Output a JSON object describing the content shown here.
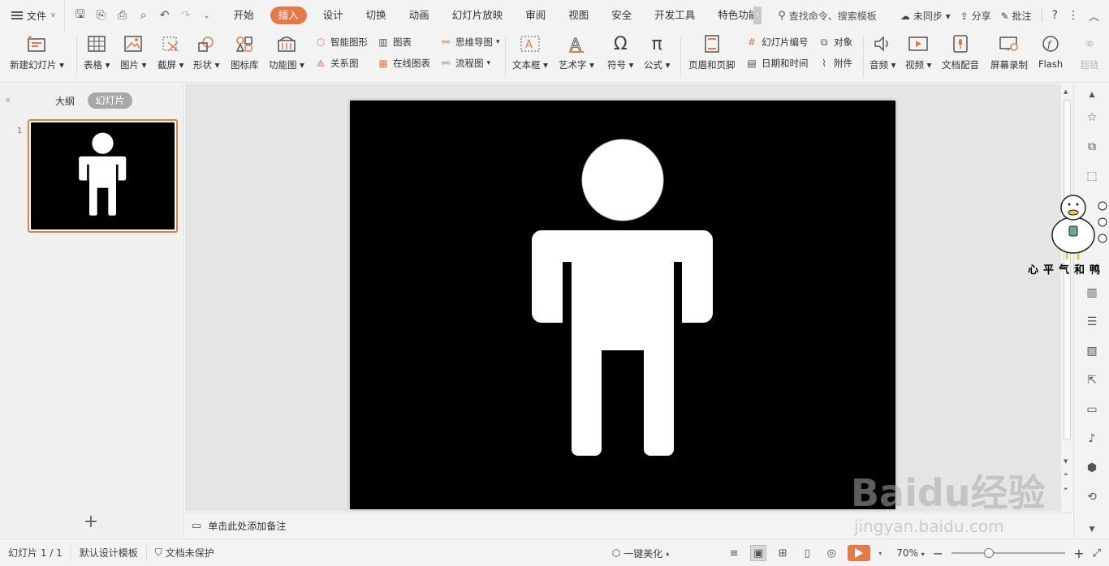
{
  "menubar": {
    "file_label": "文件",
    "tabs": [
      {
        "label": "开始"
      },
      {
        "label": "插入"
      },
      {
        "label": "设计"
      },
      {
        "label": "切换"
      },
      {
        "label": "动画"
      },
      {
        "label": "幻灯片放映"
      },
      {
        "label": "审阅"
      },
      {
        "label": "视图"
      },
      {
        "label": "安全"
      },
      {
        "label": "开发工具"
      },
      {
        "label": "特色功能"
      }
    ],
    "active_tab": "插入",
    "search_label": "查找命令、搜索模板",
    "sync_label": "未同步",
    "share_label": "分享",
    "comment_label": "批注"
  },
  "ribbon": {
    "new_slide": "新建幻灯片",
    "table": "表格",
    "picture": "图片",
    "screenshot": "截屏",
    "shape": "形状",
    "icon_lib": "图标库",
    "func_chart": "功能图",
    "smart_shape": "智能图形",
    "chart": "图表",
    "relation": "关系图",
    "online_chart": "在线图表",
    "mind_map": "思维导图",
    "flowchart": "流程图",
    "textbox": "文本框",
    "wordart": "艺术字",
    "symbol": "符号",
    "formula": "公式",
    "header_footer": "页眉和页脚",
    "slide_number": "幻灯片编号",
    "object": "对象",
    "date_time": "日期和时间",
    "attachment": "附件",
    "audio": "音频",
    "video": "视频",
    "doc_voice": "文档配音",
    "screen_record": "屏幕录制",
    "flash": "Flash",
    "hyperlink": "超链"
  },
  "leftpane": {
    "outline_tab": "大纲",
    "slides_tab": "幻灯片",
    "slide_number": "1"
  },
  "notes": {
    "placeholder": "单击此处添加备注"
  },
  "duck_caption": "心平气和鸭",
  "statusbar": {
    "slide_info": "幻灯片 1 / 1",
    "template": "默认设计模板",
    "protection": "文档未保护",
    "beautify": "一键美化",
    "zoom": "70%"
  },
  "colors": {
    "accent": "#e4794a",
    "slide_bg": "#000000",
    "figure": "#ffffff"
  },
  "watermark": {
    "brand": "Baidu经验",
    "url": "jingyan.baidu.com"
  }
}
